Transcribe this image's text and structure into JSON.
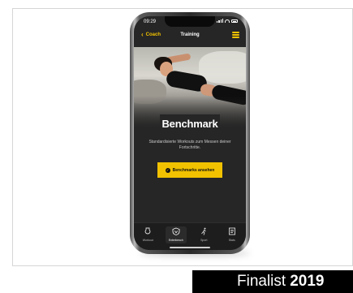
{
  "status_bar": {
    "time": "09:29"
  },
  "nav": {
    "back_label": "Coach",
    "title": "Training"
  },
  "hero": {
    "heading": "Benchmark",
    "description": "Standardisierte Workouts zum Messen deiner Fortschritte."
  },
  "cta": {
    "label": "Benchmarks ansehen"
  },
  "tabs": [
    {
      "label": "Workout",
      "icon": "kettlebell-icon"
    },
    {
      "label": "Enterbench",
      "icon": "shield-icon",
      "active": true
    },
    {
      "label": "Sport",
      "icon": "runner-icon"
    },
    {
      "label": "Stats",
      "icon": "notebook-icon"
    }
  ],
  "banner": {
    "prefix": "Finalist",
    "year": "2019"
  },
  "colors": {
    "accent": "#f2c200",
    "screen": "#262626",
    "banner": "#000000"
  }
}
